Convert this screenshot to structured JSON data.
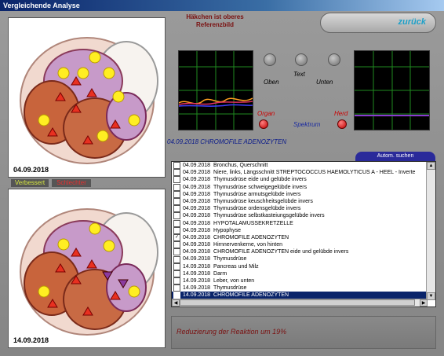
{
  "window": {
    "title": "Vergleichende Analyse"
  },
  "images": {
    "top_date": "04.09.2018",
    "bottom_date": "14.09.2018",
    "tab_improved": "Verbessert",
    "tab_worsened": "Schlechter"
  },
  "hint_text": "Häkchen ist oberes Referenzbild",
  "back_button": "zurück",
  "controls": {
    "oben": "Oben",
    "text": "Text",
    "unten": "Unten",
    "organ": "Organ",
    "herd": "Herd",
    "spektrum": "Spektrum"
  },
  "colors": {
    "organ_label": "#cc0000",
    "herd_label": "#cc0000",
    "spektrum_label": "#1a2aa0",
    "selected_row": "#0a246a"
  },
  "current_item": "04.09.2018 CHROMOFILE ADENOZYTEN",
  "search_tab": "Autom. suchen",
  "list": [
    {
      "checked": false,
      "date": "04.09.2018",
      "text": "Bronchus, Querschnitt"
    },
    {
      "checked": false,
      "date": "04.09.2018",
      "text": "Niere, links, Längsschnitt STREPTOCOCCUS HAEMOLYTICUS A  -  HEEL - Inverte"
    },
    {
      "checked": false,
      "date": "04.09.2018",
      "text": "Thymusdrüse  eide und gelübde invers"
    },
    {
      "checked": false,
      "date": "04.09.2018",
      "text": "Thymusdrüse  schweigegelübde invers"
    },
    {
      "checked": false,
      "date": "04.09.2018",
      "text": "Thymusdrüse  armutsgelübde invers"
    },
    {
      "checked": false,
      "date": "04.09.2018",
      "text": "Thymusdrüse  keuschheitsgelübde invers"
    },
    {
      "checked": false,
      "date": "04.09.2018",
      "text": "Thymusdrüse  ordensgelübde invers"
    },
    {
      "checked": false,
      "date": "04.09.2018",
      "text": "Thymusdrüse  selbstkasteiungsgelübde invers"
    },
    {
      "checked": false,
      "date": "04.09.2018",
      "text": "HYPOTALAMUSSEKRETZELLE"
    },
    {
      "checked": false,
      "date": "04.09.2018",
      "text": "Hypophyse"
    },
    {
      "checked": true,
      "date": "04.09.2018",
      "text": "CHROMOFILE ADENOZYTEN"
    },
    {
      "checked": false,
      "date": "04.09.2018",
      "text": "Hirnnervenkerne, von hinten"
    },
    {
      "checked": false,
      "date": "04.09.2018",
      "text": "CHROMOFILE ADENOZYTEN  eide und gelübde invers"
    },
    {
      "checked": false,
      "date": "04.09.2018",
      "text": "Thymusdrüse"
    },
    {
      "checked": false,
      "date": "14.09.2018",
      "text": "Pancreas und Milz"
    },
    {
      "checked": false,
      "date": "14.09.2018",
      "text": "Darm"
    },
    {
      "checked": false,
      "date": "14.09.2018",
      "text": "Leber, von unten"
    },
    {
      "checked": false,
      "date": "14.09.2018",
      "text": "Thymusdrüse"
    },
    {
      "checked": false,
      "date": "14.09.2018",
      "text": "CHROMOFILE ADENOZYTEN",
      "selected": true
    }
  ],
  "status_text": "Reduzierung der Reaktion um 19%"
}
